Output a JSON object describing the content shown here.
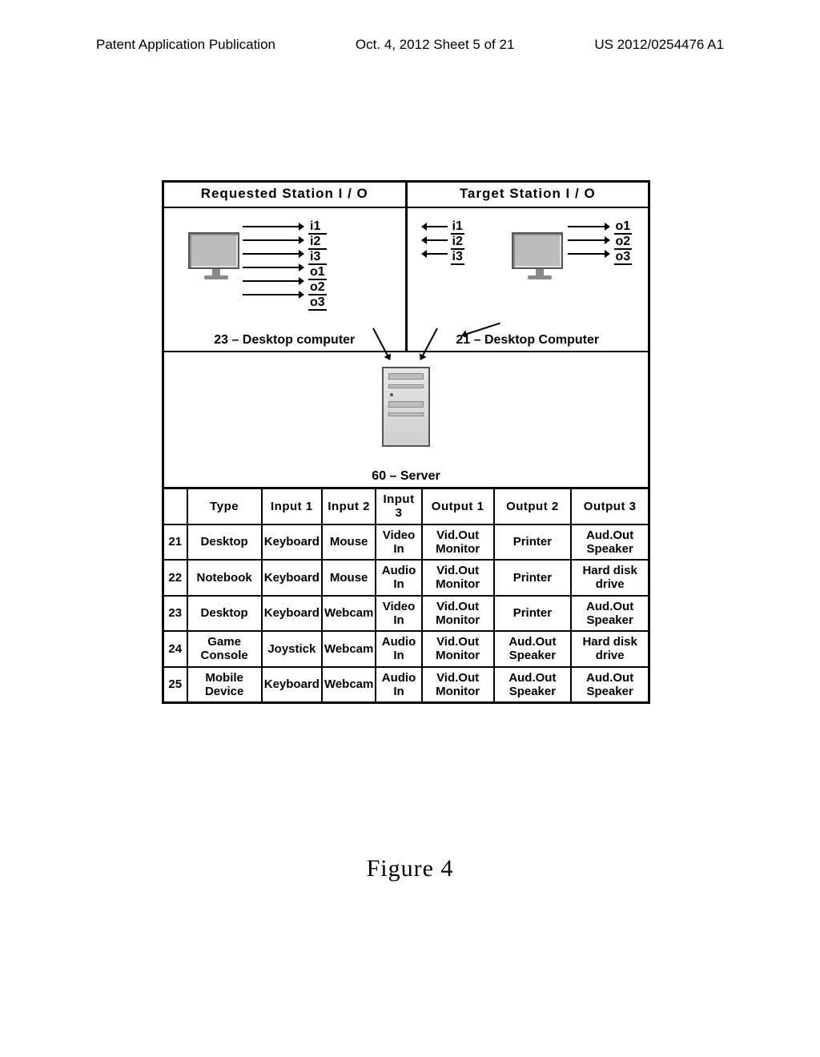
{
  "header": {
    "left": "Patent Application Publication",
    "mid": "Oct. 4, 2012  Sheet 5 of 21",
    "right": "US 2012/0254476 A1"
  },
  "figure_label": "Figure 4",
  "requested": {
    "title": "Requested Station I  / O",
    "caption": "23 – Desktop computer",
    "io": {
      "i1": "i1",
      "i2": "i2",
      "i3": "i3",
      "o1": "o1",
      "o2": "o2",
      "o3": "o3"
    }
  },
  "target": {
    "title": "Target Station I  / O",
    "caption": "21 – Desktop Computer",
    "in": {
      "i1": "i1",
      "i2": "i2",
      "i3": "i3"
    },
    "out": {
      "o1": "o1",
      "o2": "o2",
      "o3": "o3"
    }
  },
  "server": {
    "caption": "60 – Server"
  },
  "chart_data": {
    "type": "table",
    "title": "Station I/O configuration table",
    "columns": [
      "",
      "Type",
      "Input 1",
      "Input 2",
      "Input 3",
      "Output 1",
      "Output 2",
      "Output 3"
    ],
    "rows": [
      {
        "id": "21",
        "type": "Desktop",
        "in1": "Keyboard",
        "in2": "Mouse",
        "in3": "Video In",
        "out1": "Vid.Out Monitor",
        "out2": "Printer",
        "out3": "Aud.Out Speaker"
      },
      {
        "id": "22",
        "type": "Notebook",
        "in1": "Keyboard",
        "in2": "Mouse",
        "in3": "Audio In",
        "out1": "Vid.Out Monitor",
        "out2": "Printer",
        "out3": "Hard disk drive"
      },
      {
        "id": "23",
        "type": "Desktop",
        "in1": "Keyboard",
        "in2": "Webcam",
        "in3": "Video In",
        "out1": "Vid.Out Monitor",
        "out2": "Printer",
        "out3": "Aud.Out Speaker"
      },
      {
        "id": "24",
        "type": "Game Console",
        "in1": "Joystick",
        "in2": "Webcam",
        "in3": "Audio In",
        "out1": "Vid.Out Monitor",
        "out2": "Aud.Out Speaker",
        "out3": "Hard disk drive"
      },
      {
        "id": "25",
        "type": "Mobile Device",
        "in1": "Keyboard",
        "in2": "Webcam",
        "in3": "Audio In",
        "out1": "Vid.Out Monitor",
        "out2": "Aud.Out Speaker",
        "out3": "Aud.Out Speaker"
      }
    ]
  }
}
